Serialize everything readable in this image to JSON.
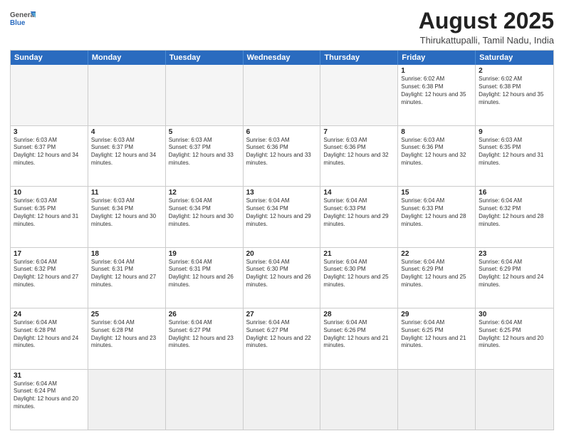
{
  "header": {
    "logo_general": "General",
    "logo_blue": "Blue",
    "month_year": "August 2025",
    "location": "Thirukattupalli, Tamil Nadu, India"
  },
  "days_of_week": [
    "Sunday",
    "Monday",
    "Tuesday",
    "Wednesday",
    "Thursday",
    "Friday",
    "Saturday"
  ],
  "weeks": [
    [
      {
        "day": "",
        "sunrise": "",
        "sunset": "",
        "daylight": "",
        "empty": true
      },
      {
        "day": "",
        "sunrise": "",
        "sunset": "",
        "daylight": "",
        "empty": true
      },
      {
        "day": "",
        "sunrise": "",
        "sunset": "",
        "daylight": "",
        "empty": true
      },
      {
        "day": "",
        "sunrise": "",
        "sunset": "",
        "daylight": "",
        "empty": true
      },
      {
        "day": "",
        "sunrise": "",
        "sunset": "",
        "daylight": "",
        "empty": true
      },
      {
        "day": "1",
        "sunrise": "Sunrise: 6:02 AM",
        "sunset": "Sunset: 6:38 PM",
        "daylight": "Daylight: 12 hours and 35 minutes."
      },
      {
        "day": "2",
        "sunrise": "Sunrise: 6:02 AM",
        "sunset": "Sunset: 6:38 PM",
        "daylight": "Daylight: 12 hours and 35 minutes."
      }
    ],
    [
      {
        "day": "3",
        "sunrise": "Sunrise: 6:03 AM",
        "sunset": "Sunset: 6:37 PM",
        "daylight": "Daylight: 12 hours and 34 minutes."
      },
      {
        "day": "4",
        "sunrise": "Sunrise: 6:03 AM",
        "sunset": "Sunset: 6:37 PM",
        "daylight": "Daylight: 12 hours and 34 minutes."
      },
      {
        "day": "5",
        "sunrise": "Sunrise: 6:03 AM",
        "sunset": "Sunset: 6:37 PM",
        "daylight": "Daylight: 12 hours and 33 minutes."
      },
      {
        "day": "6",
        "sunrise": "Sunrise: 6:03 AM",
        "sunset": "Sunset: 6:36 PM",
        "daylight": "Daylight: 12 hours and 33 minutes."
      },
      {
        "day": "7",
        "sunrise": "Sunrise: 6:03 AM",
        "sunset": "Sunset: 6:36 PM",
        "daylight": "Daylight: 12 hours and 32 minutes."
      },
      {
        "day": "8",
        "sunrise": "Sunrise: 6:03 AM",
        "sunset": "Sunset: 6:36 PM",
        "daylight": "Daylight: 12 hours and 32 minutes."
      },
      {
        "day": "9",
        "sunrise": "Sunrise: 6:03 AM",
        "sunset": "Sunset: 6:35 PM",
        "daylight": "Daylight: 12 hours and 31 minutes."
      }
    ],
    [
      {
        "day": "10",
        "sunrise": "Sunrise: 6:03 AM",
        "sunset": "Sunset: 6:35 PM",
        "daylight": "Daylight: 12 hours and 31 minutes."
      },
      {
        "day": "11",
        "sunrise": "Sunrise: 6:03 AM",
        "sunset": "Sunset: 6:34 PM",
        "daylight": "Daylight: 12 hours and 30 minutes."
      },
      {
        "day": "12",
        "sunrise": "Sunrise: 6:04 AM",
        "sunset": "Sunset: 6:34 PM",
        "daylight": "Daylight: 12 hours and 30 minutes."
      },
      {
        "day": "13",
        "sunrise": "Sunrise: 6:04 AM",
        "sunset": "Sunset: 6:34 PM",
        "daylight": "Daylight: 12 hours and 29 minutes."
      },
      {
        "day": "14",
        "sunrise": "Sunrise: 6:04 AM",
        "sunset": "Sunset: 6:33 PM",
        "daylight": "Daylight: 12 hours and 29 minutes."
      },
      {
        "day": "15",
        "sunrise": "Sunrise: 6:04 AM",
        "sunset": "Sunset: 6:33 PM",
        "daylight": "Daylight: 12 hours and 28 minutes."
      },
      {
        "day": "16",
        "sunrise": "Sunrise: 6:04 AM",
        "sunset": "Sunset: 6:32 PM",
        "daylight": "Daylight: 12 hours and 28 minutes."
      }
    ],
    [
      {
        "day": "17",
        "sunrise": "Sunrise: 6:04 AM",
        "sunset": "Sunset: 6:32 PM",
        "daylight": "Daylight: 12 hours and 27 minutes."
      },
      {
        "day": "18",
        "sunrise": "Sunrise: 6:04 AM",
        "sunset": "Sunset: 6:31 PM",
        "daylight": "Daylight: 12 hours and 27 minutes."
      },
      {
        "day": "19",
        "sunrise": "Sunrise: 6:04 AM",
        "sunset": "Sunset: 6:31 PM",
        "daylight": "Daylight: 12 hours and 26 minutes."
      },
      {
        "day": "20",
        "sunrise": "Sunrise: 6:04 AM",
        "sunset": "Sunset: 6:30 PM",
        "daylight": "Daylight: 12 hours and 26 minutes."
      },
      {
        "day": "21",
        "sunrise": "Sunrise: 6:04 AM",
        "sunset": "Sunset: 6:30 PM",
        "daylight": "Daylight: 12 hours and 25 minutes."
      },
      {
        "day": "22",
        "sunrise": "Sunrise: 6:04 AM",
        "sunset": "Sunset: 6:29 PM",
        "daylight": "Daylight: 12 hours and 25 minutes."
      },
      {
        "day": "23",
        "sunrise": "Sunrise: 6:04 AM",
        "sunset": "Sunset: 6:29 PM",
        "daylight": "Daylight: 12 hours and 24 minutes."
      }
    ],
    [
      {
        "day": "24",
        "sunrise": "Sunrise: 6:04 AM",
        "sunset": "Sunset: 6:28 PM",
        "daylight": "Daylight: 12 hours and 24 minutes."
      },
      {
        "day": "25",
        "sunrise": "Sunrise: 6:04 AM",
        "sunset": "Sunset: 6:28 PM",
        "daylight": "Daylight: 12 hours and 23 minutes."
      },
      {
        "day": "26",
        "sunrise": "Sunrise: 6:04 AM",
        "sunset": "Sunset: 6:27 PM",
        "daylight": "Daylight: 12 hours and 23 minutes."
      },
      {
        "day": "27",
        "sunrise": "Sunrise: 6:04 AM",
        "sunset": "Sunset: 6:27 PM",
        "daylight": "Daylight: 12 hours and 22 minutes."
      },
      {
        "day": "28",
        "sunrise": "Sunrise: 6:04 AM",
        "sunset": "Sunset: 6:26 PM",
        "daylight": "Daylight: 12 hours and 21 minutes."
      },
      {
        "day": "29",
        "sunrise": "Sunrise: 6:04 AM",
        "sunset": "Sunset: 6:25 PM",
        "daylight": "Daylight: 12 hours and 21 minutes."
      },
      {
        "day": "30",
        "sunrise": "Sunrise: 6:04 AM",
        "sunset": "Sunset: 6:25 PM",
        "daylight": "Daylight: 12 hours and 20 minutes."
      }
    ],
    [
      {
        "day": "31",
        "sunrise": "Sunrise: 6:04 AM",
        "sunset": "Sunset: 6:24 PM",
        "daylight": "Daylight: 12 hours and 20 minutes."
      },
      {
        "day": "",
        "empty": true
      },
      {
        "day": "",
        "empty": true
      },
      {
        "day": "",
        "empty": true
      },
      {
        "day": "",
        "empty": true
      },
      {
        "day": "",
        "empty": true
      },
      {
        "day": "",
        "empty": true
      }
    ]
  ]
}
